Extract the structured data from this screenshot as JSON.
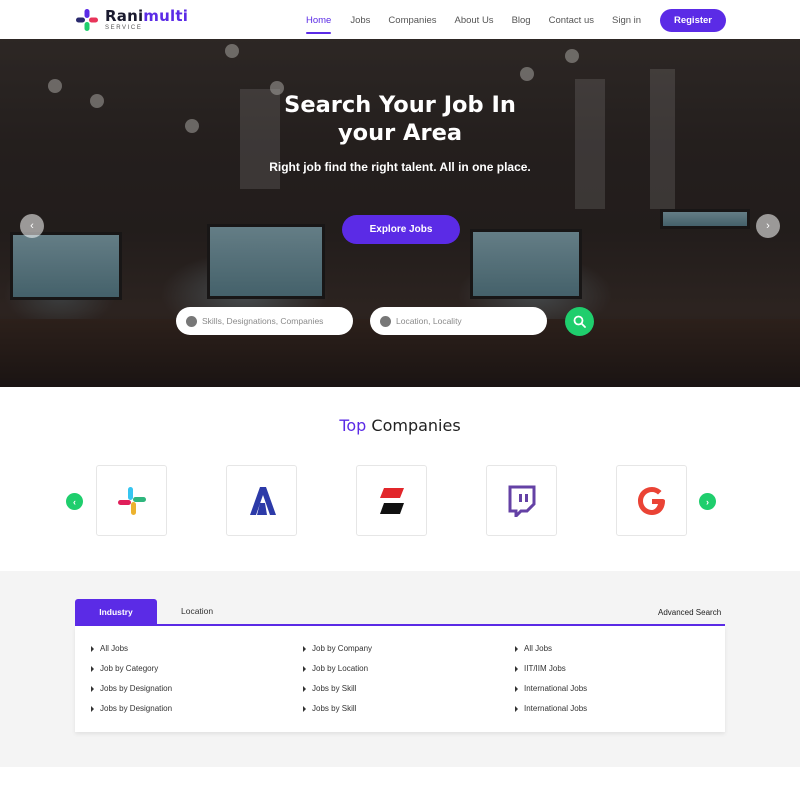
{
  "header": {
    "logo": {
      "name_part1": "Rani",
      "name_part2": "multi",
      "tagline": "SERVICE"
    },
    "nav": [
      {
        "label": "Home",
        "active": true
      },
      {
        "label": "Jobs",
        "active": false
      },
      {
        "label": "Companies",
        "active": false
      },
      {
        "label": "About Us",
        "active": false
      },
      {
        "label": "Blog",
        "active": false
      },
      {
        "label": "Contact us",
        "active": false
      },
      {
        "label": "Sign in",
        "active": false
      }
    ],
    "register_label": "Register"
  },
  "hero": {
    "title_line1": "Search Your Job In",
    "title_line2": "your Area",
    "subtitle": "Right job find the right talent. All in one place.",
    "explore_label": "Explore Jobs",
    "prev_icon": "chevron-left-icon",
    "next_icon": "chevron-right-icon",
    "search": {
      "skills_placeholder": "Skills, Designations, Companies",
      "location_placeholder": "Location, Locality",
      "submit_icon": "search-icon"
    }
  },
  "top_companies": {
    "title_accent": "Top",
    "title_rest": "Companies",
    "companies": [
      {
        "name": "slack-logo"
      },
      {
        "name": "a-logo"
      },
      {
        "name": "stripes-logo"
      },
      {
        "name": "twitch-logo"
      },
      {
        "name": "google-logo"
      }
    ]
  },
  "categories": {
    "tabs": [
      {
        "label": "Industry",
        "active": true
      },
      {
        "label": "Location",
        "active": false
      }
    ],
    "advanced_search_label": "Advanced Search",
    "columns": [
      [
        "All Jobs",
        "Job by Category",
        "Jobs by Designation",
        "Jobs by Designation"
      ],
      [
        "Job by Company",
        "Job by Location",
        "Jobs by Skill",
        "Jobs by Skill"
      ],
      [
        "All Jobs",
        "IIT/IIM Jobs",
        "International Jobs",
        "International Jobs"
      ]
    ]
  },
  "colors": {
    "brand": "#5b2be6",
    "accent_green": "#1fce6d",
    "section_bg": "#f4f4f4"
  }
}
